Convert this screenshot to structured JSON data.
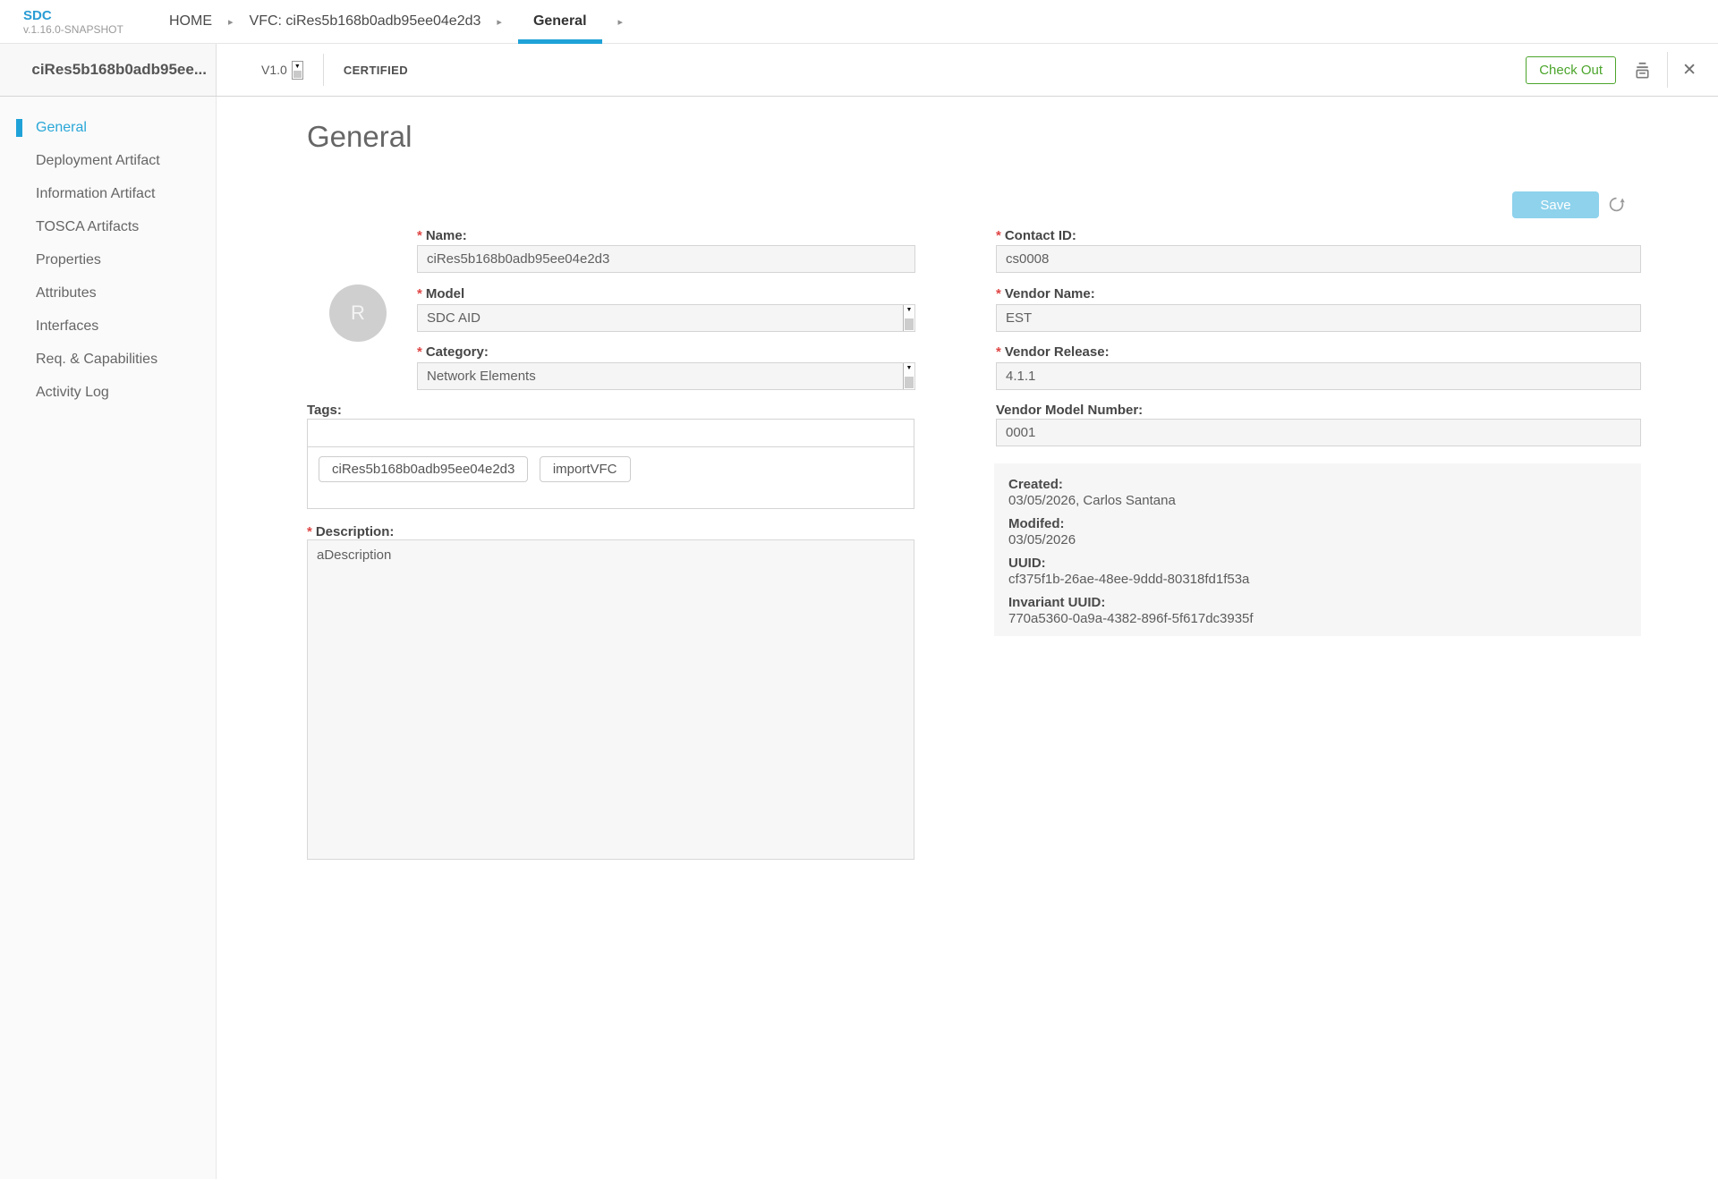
{
  "app": {
    "name": "SDC",
    "version": "v.1.16.0-SNAPSHOT"
  },
  "icons": {
    "breadcrumb_arrow": "▸",
    "close": "✕",
    "select_arrow": "▼"
  },
  "ui": {
    "required_marker": "*"
  },
  "breadcrumb": [
    {
      "label": "HOME"
    },
    {
      "label": "VFC: ciRes5b168b0adb95ee04e2d3"
    },
    {
      "label": "General"
    }
  ],
  "header": {
    "title": "ciRes5b168b0adb95ee...",
    "version_label": "V1.0",
    "lifecycle_state": "CERTIFIED",
    "checkout_label": "Check Out"
  },
  "sidebar": {
    "items": [
      {
        "label": "General"
      },
      {
        "label": "Deployment Artifact"
      },
      {
        "label": "Information Artifact"
      },
      {
        "label": "TOSCA Artifacts"
      },
      {
        "label": "Properties"
      },
      {
        "label": "Attributes"
      },
      {
        "label": "Interfaces"
      },
      {
        "label": "Req. & Capabilities"
      },
      {
        "label": "Activity Log"
      }
    ]
  },
  "main": {
    "heading": "General",
    "save_label": "Save",
    "avatar_letter": "R",
    "fields": {
      "name": {
        "label": "Name:",
        "value": "ciRes5b168b0adb95ee04e2d3"
      },
      "model": {
        "label": "Model",
        "value": "SDC AID"
      },
      "category": {
        "label": "Category:",
        "value": "Network Elements"
      },
      "contact_id": {
        "label": "Contact ID:",
        "value": "cs0008"
      },
      "vendor_name": {
        "label": "Vendor Name:",
        "value": "EST"
      },
      "vendor_release": {
        "label": "Vendor Release:",
        "value": "4.1.1"
      },
      "vendor_model_number": {
        "label": "Vendor Model Number:",
        "value": "0001"
      },
      "tags": {
        "label": "Tags:",
        "value": "",
        "chips": [
          "ciRes5b168b0adb95ee04e2d3",
          "importVFC"
        ]
      },
      "description": {
        "label": "Description:",
        "value": "aDescription"
      }
    },
    "meta": {
      "created_label": "Created:",
      "created_value": "03/05/2026, Carlos Santana",
      "modified_label": "Modifed:",
      "modified_value": "03/05/2026",
      "uuid_label": "UUID:",
      "uuid_value": "cf375f1b-26ae-48ee-9ddd-80318fd1f53a",
      "invariant_uuid_label": "Invariant UUID:",
      "invariant_uuid_value": "770a5360-0a9a-4382-896f-5f617dc3935f"
    }
  },
  "colors": {
    "accent_blue": "#1fa2d8",
    "logo_blue": "#2a9cd4",
    "certified_green": "#4ca52c",
    "save_disabled_blue": "#8ed2ec",
    "required_red": "#e04646"
  }
}
